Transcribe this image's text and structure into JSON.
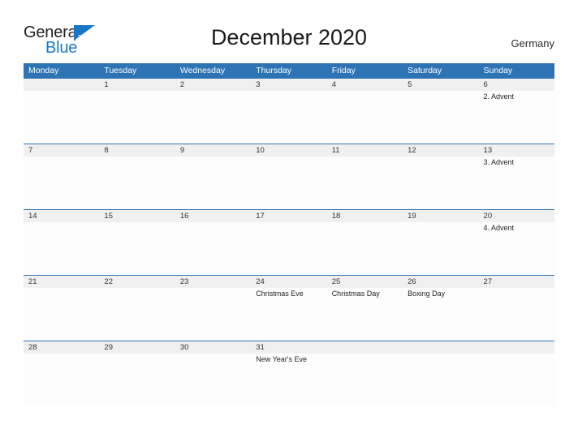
{
  "brand": {
    "name_part1": "General",
    "name_part2": "Blue",
    "logo_icon": "blue-flag-triangle-icon"
  },
  "header": {
    "title": "December 2020",
    "country": "Germany"
  },
  "calendar": {
    "month": "December",
    "year": "2020",
    "locale_country": "Germany",
    "accent_color": "#2e74b5",
    "number_band_color": "#f0f0f0",
    "weekdays": [
      "Monday",
      "Tuesday",
      "Wednesday",
      "Thursday",
      "Friday",
      "Saturday",
      "Sunday"
    ],
    "weeks": [
      {
        "days": [
          {
            "date": "",
            "event": ""
          },
          {
            "date": "1",
            "event": ""
          },
          {
            "date": "2",
            "event": ""
          },
          {
            "date": "3",
            "event": ""
          },
          {
            "date": "4",
            "event": ""
          },
          {
            "date": "5",
            "event": ""
          },
          {
            "date": "6",
            "event": "2. Advent"
          }
        ]
      },
      {
        "days": [
          {
            "date": "7",
            "event": ""
          },
          {
            "date": "8",
            "event": ""
          },
          {
            "date": "9",
            "event": ""
          },
          {
            "date": "10",
            "event": ""
          },
          {
            "date": "11",
            "event": ""
          },
          {
            "date": "12",
            "event": ""
          },
          {
            "date": "13",
            "event": "3. Advent"
          }
        ]
      },
      {
        "days": [
          {
            "date": "14",
            "event": ""
          },
          {
            "date": "15",
            "event": ""
          },
          {
            "date": "16",
            "event": ""
          },
          {
            "date": "17",
            "event": ""
          },
          {
            "date": "18",
            "event": ""
          },
          {
            "date": "19",
            "event": ""
          },
          {
            "date": "20",
            "event": "4. Advent"
          }
        ]
      },
      {
        "days": [
          {
            "date": "21",
            "event": ""
          },
          {
            "date": "22",
            "event": ""
          },
          {
            "date": "23",
            "event": ""
          },
          {
            "date": "24",
            "event": "Christmas Eve"
          },
          {
            "date": "25",
            "event": "Christmas Day"
          },
          {
            "date": "26",
            "event": "Boxing Day"
          },
          {
            "date": "27",
            "event": ""
          }
        ]
      },
      {
        "days": [
          {
            "date": "28",
            "event": ""
          },
          {
            "date": "29",
            "event": ""
          },
          {
            "date": "30",
            "event": ""
          },
          {
            "date": "31",
            "event": "New Year's Eve"
          },
          {
            "date": "",
            "event": ""
          },
          {
            "date": "",
            "event": ""
          },
          {
            "date": "",
            "event": ""
          }
        ]
      }
    ]
  }
}
